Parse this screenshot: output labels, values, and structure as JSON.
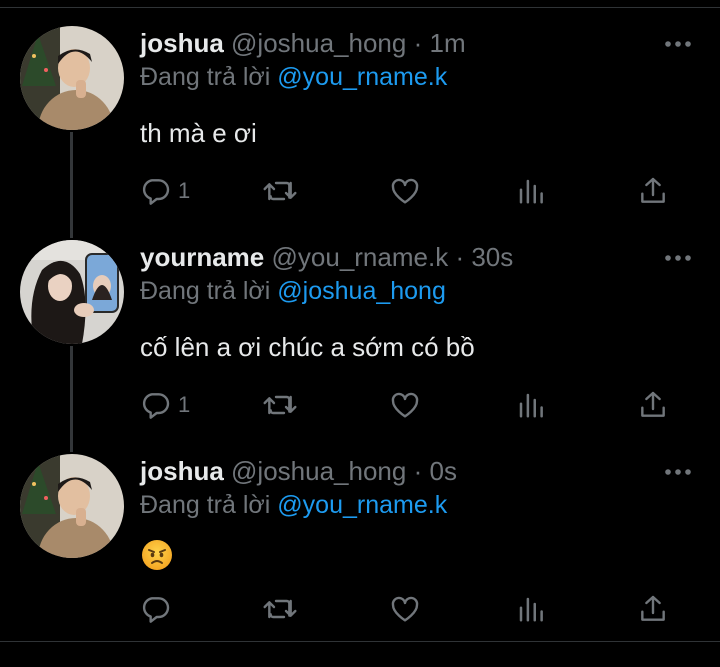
{
  "reply_prefix": "Đang trả lời",
  "tweets": [
    {
      "name": "joshua",
      "handle": "@joshua_hong",
      "separator": "·",
      "time": "1m",
      "replying_to": "@you_rname.k",
      "text": "th mà e ơi",
      "reply_count": "1"
    },
    {
      "name": "yourname",
      "handle": "@you_rname.k",
      "separator": "·",
      "time": "30s",
      "replying_to": "@joshua_hong",
      "text": "cố lên a ơi chúc a sớm có bồ",
      "reply_count": "1"
    },
    {
      "name": "joshua",
      "handle": "@joshua_hong",
      "separator": "·",
      "time": "0s",
      "replying_to": "@you_rname.k",
      "emoji": "angry-face",
      "reply_count": ""
    }
  ],
  "icons": [
    "reply-icon",
    "retweet-icon",
    "like-icon",
    "views-icon",
    "share-icon",
    "more-icon"
  ],
  "colors": {
    "accent": "#1d9bf0",
    "muted": "#71767b",
    "text": "#e7e9ea",
    "background": "#000000"
  }
}
